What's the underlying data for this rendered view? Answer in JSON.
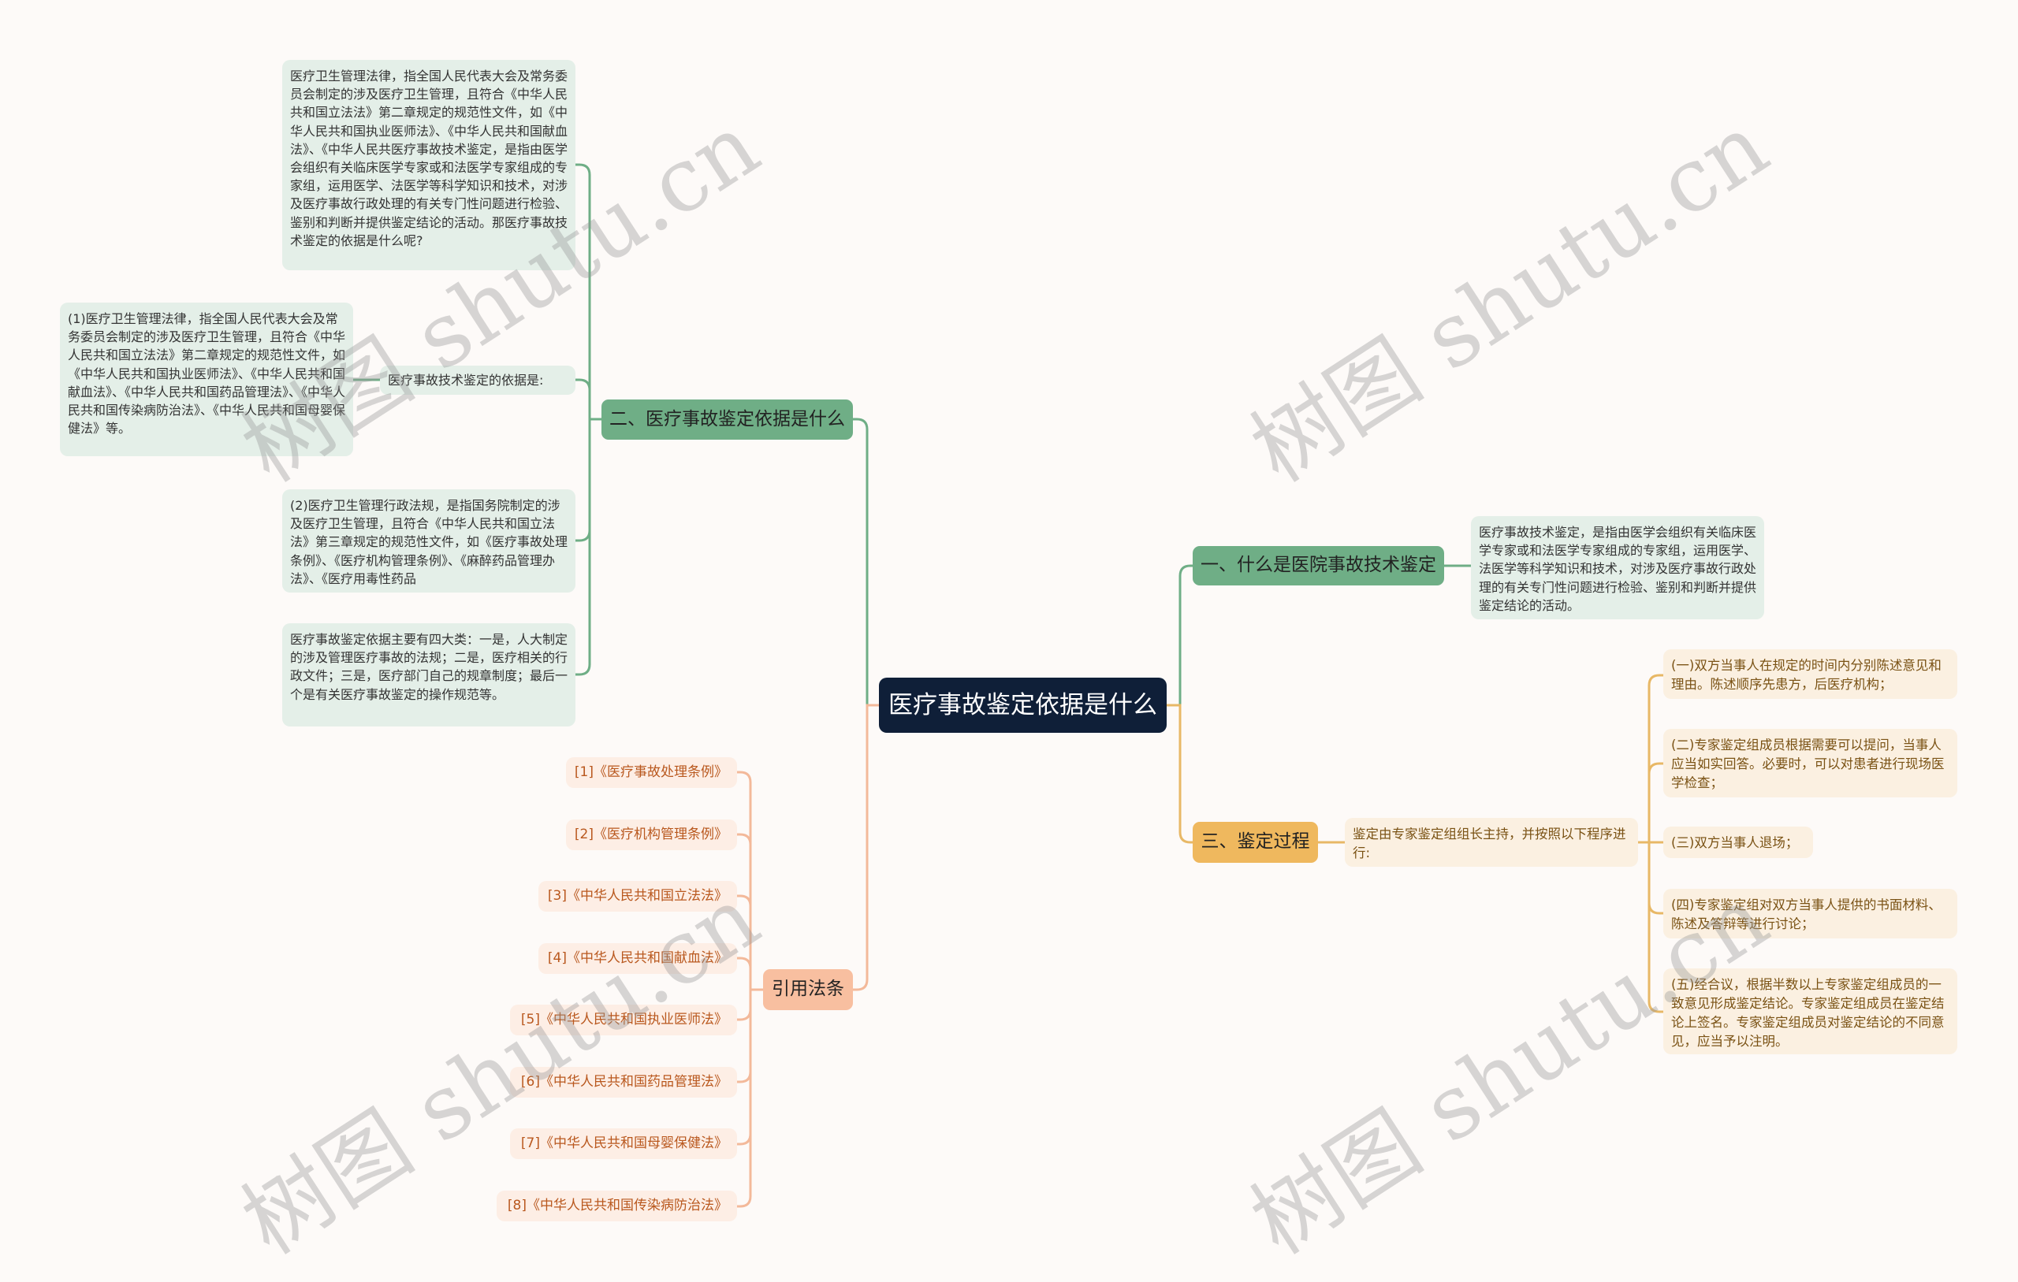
{
  "root": {
    "title": "医疗事故鉴定依据是什么"
  },
  "colors": {
    "root_bg": "#0f1f38",
    "green_branch": "#6fae86",
    "yellow_branch": "#efb85e",
    "peach_branch": "#f8bfa0",
    "green_line": "#6fae86",
    "yellow_line": "#e8b866",
    "peach_line": "#f3b99a"
  },
  "branches": {
    "b1": {
      "label": "一、什么是医院事故技术鉴定",
      "children": [
        "医疗事故技术鉴定，是指由医学会组织有关临床医学专家或和法医学专家组成的专家组，运用医学、法医学等科学知识和技术，对涉及医疗事故行政处理的有关专门性问题进行检验、鉴别和判断并提供鉴定结论的活动。"
      ]
    },
    "b2": {
      "label": "二、医疗事故鉴定依据是什么",
      "children": [
        "医疗卫生管理法律，指全国人民代表大会及常务委员会制定的涉及医疗卫生管理，且符合《中华人民共和国立法法》第二章规定的规范性文件，如《中华人民共和国执业医师法》、《中华人民共和国献血法》、《中华人民共医疗事故技术鉴定，是指由医学会组织有关临床医学专家或和法医学专家组成的专家组，运用医学、法医学等科学知识和技术，对涉及医疗事故行政处理的有关专门性问题进行检验、鉴别和判断并提供鉴定结论的活动。那医疗事故技术鉴定的依据是什么呢?",
        "医疗事故技术鉴定的依据是:",
        "(2)医疗卫生管理行政法规，是指国务院制定的涉及医疗卫生管理，且符合《中华人民共和国立法法》第三章规定的规范性文件，如《医疗事故处理条例》、《医疗机构管理条例》、《麻醉药品管理办法》、《医疗用毒性药品",
        "医疗事故鉴定依据主要有四大类：一是，人大制定的涉及管理医疗事故的法规；二是，医疗相关的行政文件；三是，医疗部门自己的规章制度；最后一个是有关医疗事故鉴定的操作规范等。"
      ],
      "grandchild": "(1)医疗卫生管理法律，指全国人民代表大会及常务委员会制定的涉及医疗卫生管理，且符合《中华人民共和国立法法》第二章规定的规范性文件，如《中华人民共和国执业医师法》、《中华人民共和国献血法》、《中华人民共和国药品管理法》、《中华人民共和国传染病防治法》、《中华人民共和国母婴保健法》等。"
    },
    "b3": {
      "label": "三、鉴定过程",
      "child": "鉴定由专家鉴定组组长主持，并按照以下程序进行:",
      "steps": [
        "(一)双方当事人在规定的时间内分别陈述意见和理由。陈述顺序先患方，后医疗机构；",
        "(二)专家鉴定组成员根据需要可以提问，当事人应当如实回答。必要时，可以对患者进行现场医学检查；",
        "(三)双方当事人退场；",
        "(四)专家鉴定组对双方当事人提供的书面材料、陈述及答辩等进行讨论；",
        "(五)经合议，根据半数以上专家鉴定组成员的一致意见形成鉴定结论。专家鉴定组成员在鉴定结论上签名。专家鉴定组成员对鉴定结论的不同意见，应当予以注明。"
      ]
    },
    "b4": {
      "label": "引用法条",
      "children": [
        "[1]《医疗事故处理条例》",
        "[2]《医疗机构管理条例》",
        "[3]《中华人民共和国立法法》",
        "[4]《中华人民共和国献血法》",
        "[5]《中华人民共和国执业医师法》",
        "[6]《中华人民共和国药品管理法》",
        "[7]《中华人民共和国母婴保健法》",
        "[8]《中华人民共和国传染病防治法》"
      ]
    }
  },
  "watermark": "树图 shutu.cn"
}
